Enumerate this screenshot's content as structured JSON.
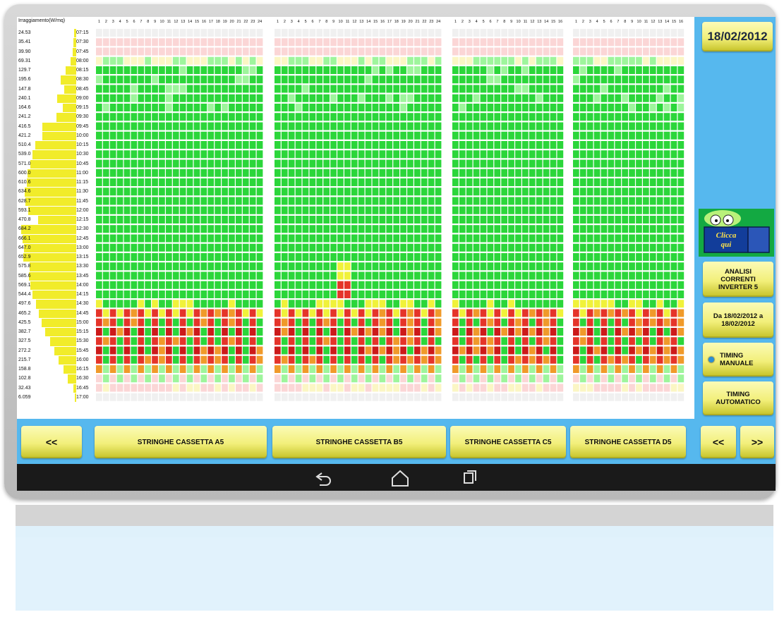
{
  "header": {
    "label": "Irraggiamento(W/mq)"
  },
  "groups": [
    {
      "name": "STRINGHE CASSETTA A5",
      "count": 24
    },
    {
      "name": "STRINGHE CASSETTA B5",
      "count": 24
    },
    {
      "name": "STRINGHE CASSETTA C5",
      "count": 16
    },
    {
      "name": "STRINGHE CASSETTA D5",
      "count": 16
    }
  ],
  "rows": [
    {
      "time": "07:15",
      "irr": "24.53"
    },
    {
      "time": "07:30",
      "irr": "35.41"
    },
    {
      "time": "07:45",
      "irr": "39.90"
    },
    {
      "time": "08:00",
      "irr": "69.31"
    },
    {
      "time": "08:15",
      "irr": "129.7"
    },
    {
      "time": "08:30",
      "irr": "195.6"
    },
    {
      "time": "08:45",
      "irr": "147.8"
    },
    {
      "time": "09:00",
      "irr": "240.1"
    },
    {
      "time": "09:15",
      "irr": "164.6"
    },
    {
      "time": "09:30",
      "irr": "241.2"
    },
    {
      "time": "09:45",
      "irr": "416.5"
    },
    {
      "time": "10:00",
      "irr": "421.2"
    },
    {
      "time": "10:15",
      "irr": "510.4"
    },
    {
      "time": "10:30",
      "irr": "539.0"
    },
    {
      "time": "10:45",
      "irr": "571.0"
    },
    {
      "time": "11:00",
      "irr": "600.0"
    },
    {
      "time": "11:15",
      "irr": "610.6"
    },
    {
      "time": "11:30",
      "irr": "634.6"
    },
    {
      "time": "11:45",
      "irr": "628.7"
    },
    {
      "time": "12:00",
      "irr": "593.1"
    },
    {
      "time": "12:15",
      "irr": "470.8"
    },
    {
      "time": "12:30",
      "irr": "684.2"
    },
    {
      "time": "12:45",
      "irr": "666.1"
    },
    {
      "time": "13:00",
      "irr": "647.0"
    },
    {
      "time": "13:15",
      "irr": "652.9"
    },
    {
      "time": "13:30",
      "irr": "575.8"
    },
    {
      "time": "13:45",
      "irr": "585.6"
    },
    {
      "time": "14:00",
      "irr": "569.1"
    },
    {
      "time": "14:15",
      "irr": "544.4"
    },
    {
      "time": "14:30",
      "irr": "497.6"
    },
    {
      "time": "14:45",
      "irr": "465.2"
    },
    {
      "time": "15:00",
      "irr": "425.5"
    },
    {
      "time": "15:15",
      "irr": "382.7"
    },
    {
      "time": "15:30",
      "irr": "327.5"
    },
    {
      "time": "15:45",
      "irr": "272.2"
    },
    {
      "time": "16:00",
      "irr": "215.7"
    },
    {
      "time": "16:15",
      "irr": "158.8"
    },
    {
      "time": "16:30",
      "irr": "102.8"
    },
    {
      "time": "16:45",
      "irr": "32.43"
    },
    {
      "time": "17:00",
      "irr": "6.059"
    }
  ],
  "colors": {
    "empty": "#f0f0f0",
    "light_red": "#fbd6d6",
    "light_yellow": "#fbf6c4",
    "light_green": "#9ef59c",
    "green": "#2bd63a",
    "yellow": "#f0f23a",
    "orange": "#f09a2a",
    "red": "#e5342a",
    "dark_red": "#cc1a1a",
    "irr_bar": "#f1ec2a"
  },
  "side": {
    "date": "18/02/2012",
    "mascot_text": "Clicca qui",
    "analisi": "ANALISI CORRENTI INVERTER 5",
    "range": "Da 18/02/2012 a 18/02/2012",
    "timing_manuale": "TIMING MANUALE",
    "timing_automatico": "TIMING AUTOMATICO"
  },
  "bottom": {
    "prev_left": "<<",
    "prev_right": "<<",
    "next_right": ">>"
  },
  "navbar": {
    "icons": [
      "back-icon",
      "home-icon",
      "recent-apps-icon"
    ]
  }
}
